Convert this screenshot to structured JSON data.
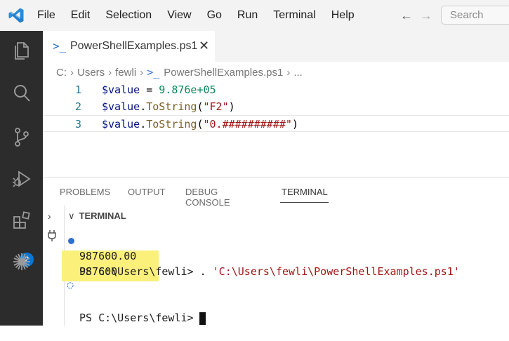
{
  "menu": [
    "File",
    "Edit",
    "Selection",
    "View",
    "Go",
    "Run",
    "Terminal",
    "Help"
  ],
  "search": {
    "placeholder": "Search"
  },
  "activity_bar": {
    "icons": [
      "explorer-icon",
      "search-icon",
      "source-control-icon",
      "run-debug-icon",
      "extensions-icon",
      "remote-icon"
    ],
    "extensions_badge": "2"
  },
  "editor": {
    "tab": {
      "label": "PowerShellExamples.ps1",
      "close": "✕"
    },
    "breadcrumb": [
      "C:",
      "Users",
      "fewli",
      "PowerShellExamples.ps1",
      "..."
    ],
    "lines": [
      {
        "number": "1",
        "tokens": [
          {
            "t": "$value",
            "c": "var"
          },
          {
            "t": " = ",
            "c": "op"
          },
          {
            "t": "9.876e+05",
            "c": "num"
          }
        ]
      },
      {
        "number": "2",
        "tokens": [
          {
            "t": "$value",
            "c": "var"
          },
          {
            "t": ".",
            "c": "op"
          },
          {
            "t": "ToString",
            "c": "fn"
          },
          {
            "t": "(",
            "c": "op"
          },
          {
            "t": "\"F2\"",
            "c": "str"
          },
          {
            "t": ")",
            "c": "op"
          }
        ]
      },
      {
        "number": "3",
        "tokens": [
          {
            "t": "$value",
            "c": "var"
          },
          {
            "t": ".",
            "c": "op"
          },
          {
            "t": "ToString",
            "c": "fn"
          },
          {
            "t": "(",
            "c": "op"
          },
          {
            "t": "\"0.##########\"",
            "c": "str"
          },
          {
            "t": ")",
            "c": "op"
          }
        ]
      }
    ]
  },
  "panel": {
    "tabs": [
      "PROBLEMS",
      "OUTPUT",
      "DEBUG CONSOLE",
      "TERMINAL"
    ],
    "active_tab": "TERMINAL",
    "section_title": "TERMINAL",
    "terminal": {
      "prompt1": "PS C:\\Users\\fewli> . ",
      "command_path": "'C:\\Users\\fewli\\PowerShellExamples.ps1'",
      "output": [
        "987600.00",
        "987600"
      ],
      "prompt2": "PS C:\\Users\\fewli>"
    }
  },
  "colors": {
    "accent": "#0078d4",
    "highlight": "#fbf07a",
    "activity_bg": "#2c2c2c"
  }
}
